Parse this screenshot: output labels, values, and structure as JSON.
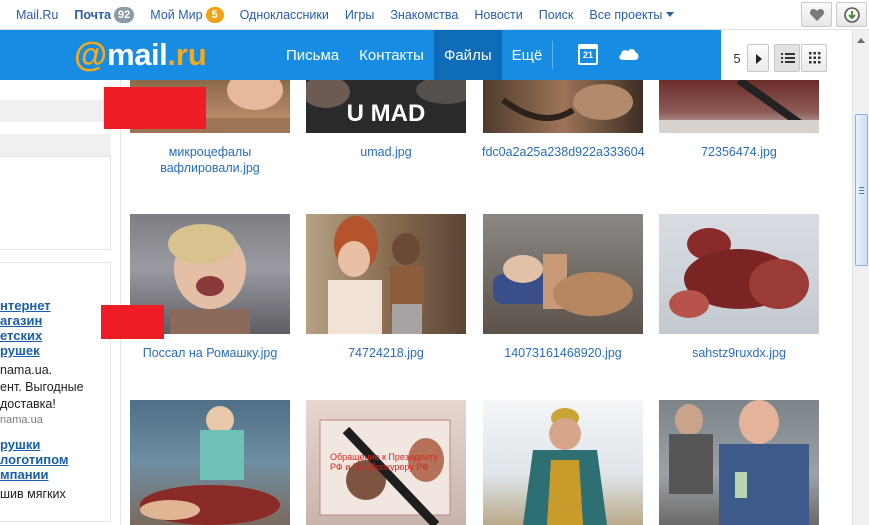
{
  "portal": {
    "links": [
      {
        "label": "Mail.Ru",
        "badge": ""
      },
      {
        "label": "Почта",
        "badge": "92"
      },
      {
        "label": "Мой Мир",
        "badge": "5"
      },
      {
        "label": "Одноклассники",
        "badge": ""
      },
      {
        "label": "Игры",
        "badge": ""
      },
      {
        "label": "Знакомства",
        "badge": ""
      },
      {
        "label": "Новости",
        "badge": ""
      },
      {
        "label": "Поиск",
        "badge": ""
      },
      {
        "label": "Все проекты",
        "badge": ""
      }
    ],
    "icons": [
      "heart-icon",
      "download-icon"
    ]
  },
  "header": {
    "logo": {
      "at": "@",
      "word": "mail",
      "dot_ru": ".ru"
    },
    "nav": [
      "Письма",
      "Контакты",
      "Файлы",
      "Ещё"
    ],
    "active_nav": "Файлы",
    "calendar_day": "21",
    "cloud_icon": "cloud-icon",
    "brand_color": "#168de2",
    "accent_color": "#f7a81b"
  },
  "pager": {
    "page": "5"
  },
  "sidebar": {
    "ad1": {
      "title_lines": [
        "нтернет",
        "агазин",
        "етских",
        "рушек"
      ],
      "text_lines": [
        "nama.ua.",
        "ент. Выгодные",
        "доставка!"
      ],
      "domain": "nama.ua"
    },
    "ad2": {
      "title_lines": [
        "рушки",
        "логотипом",
        "мпании"
      ],
      "text_lines": [
        "шив мягких"
      ]
    }
  },
  "files": [
    {
      "caption": "микроцефалы вафлировали.jpg",
      "overlay_text": ""
    },
    {
      "caption": "umad.jpg",
      "overlay_text": "U MAD"
    },
    {
      "caption": "fdc0a2a25a238d922a333604",
      "overlay_text": ""
    },
    {
      "caption": "72356474.jpg",
      "overlay_text": ""
    },
    {
      "caption": "Поссал на Ромашку.jpg",
      "overlay_text": ""
    },
    {
      "caption": "74724218.jpg",
      "overlay_text": ""
    },
    {
      "caption": "14073161468920.jpg",
      "overlay_text": ""
    },
    {
      "caption": "sahstz9ruxdx.jpg",
      "overlay_text": ""
    },
    {
      "caption": "",
      "overlay_text": ""
    },
    {
      "caption": "",
      "overlay_text": "Обращение к Президенту РФ и Ген.Прокурору РФ"
    },
    {
      "caption": "",
      "overlay_text": ""
    },
    {
      "caption": "",
      "overlay_text": ""
    }
  ]
}
